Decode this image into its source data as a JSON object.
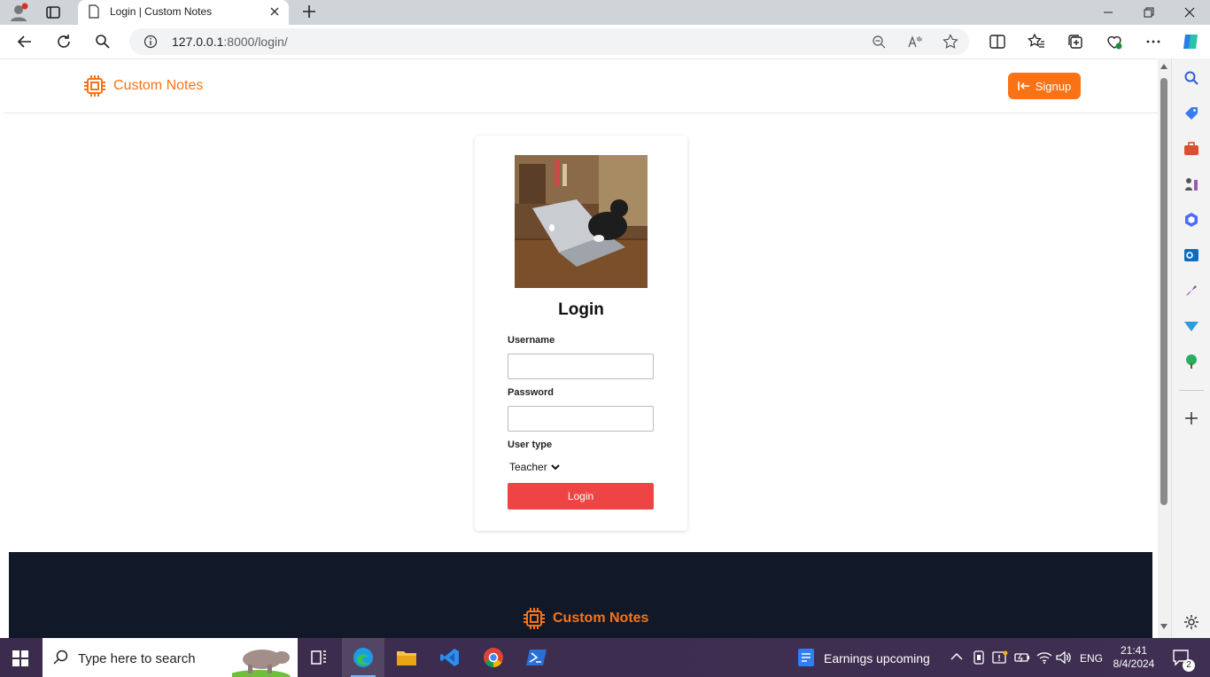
{
  "browser": {
    "tab_title": "Login | Custom Notes",
    "url_host": "127.0.0.1",
    "url_rest": ":8000/login/"
  },
  "navbar": {
    "brand": "Custom Notes",
    "signup_label": "Signup"
  },
  "login": {
    "heading": "Login",
    "username_label": "Username",
    "password_label": "Password",
    "usertype_label": "User type",
    "usertype_selected": "Teacher",
    "submit_label": "Login"
  },
  "footer": {
    "brand": "Custom Notes"
  },
  "taskbar": {
    "search_placeholder": "Type here to search",
    "news": "Earnings upcoming",
    "lang": "ENG",
    "time": "21:41",
    "date": "8/4/2024",
    "notif_count": "2"
  },
  "colors": {
    "accent": "#f97316",
    "login_button": "#ef4444",
    "footer_bg": "#111827"
  }
}
